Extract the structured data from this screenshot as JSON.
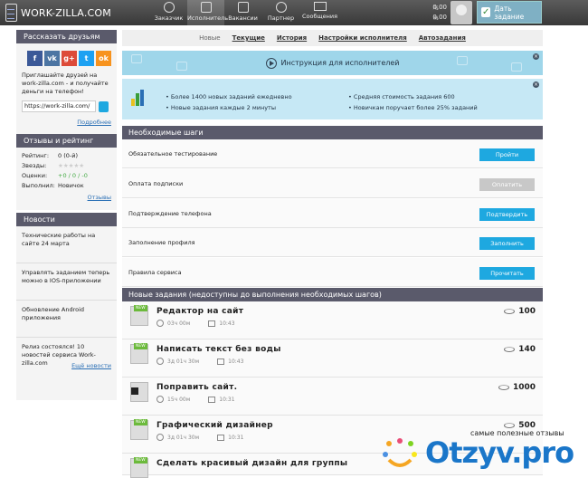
{
  "header": {
    "logo": "WORK-ZILLA.COM",
    "nav": [
      {
        "label": "Заказчик"
      },
      {
        "label": "Исполнитель"
      },
      {
        "label": "Вакансии"
      },
      {
        "label": "Партнер"
      },
      {
        "label": "Сообщения"
      }
    ],
    "balance1": "0,00",
    "balance2": "0,00",
    "task_button": "Дать задание"
  },
  "sidebar": {
    "share": {
      "title": "Рассказать друзьям",
      "text": "Приглашайте друзей на work-zilla.com - и получайте деньги на телефон!",
      "link_value": "https://work-zilla.com/",
      "more": "Подробнее",
      "networks": [
        {
          "label": "f",
          "color": "#3b5998"
        },
        {
          "label": "vk",
          "color": "#4c75a3"
        },
        {
          "label": "g+",
          "color": "#dd4b39"
        },
        {
          "label": "t",
          "color": "#1da1f2"
        },
        {
          "label": "ok",
          "color": "#f7931e"
        }
      ]
    },
    "rating": {
      "title": "Отзывы и рейтинг",
      "rows": [
        {
          "k": "Рейтинг:",
          "v": "0 (0-й)"
        },
        {
          "k": "Звезды:",
          "v": "★★★★★"
        },
        {
          "k": "Оценки:",
          "v": "+0 / 0 / -0"
        },
        {
          "k": "Выполнил:",
          "v": "Новичок"
        }
      ],
      "reviews": "Отзывы"
    },
    "news": {
      "title": "Новости",
      "items": [
        "Технические работы на сайте 24 марта",
        "Управлять заданием теперь можно в IOS-приложении",
        "Обновление Android приложения",
        "Релиз состоялся! 10 новостей сервиса Work-zilla.com"
      ],
      "more": "Ещё новости"
    }
  },
  "tabs": [
    {
      "label": "Новые"
    },
    {
      "label": "Текущие"
    },
    {
      "label": "История"
    },
    {
      "label": "Настройки исполнителя"
    },
    {
      "label": "Автозадания"
    }
  ],
  "promo": {
    "text": "Инструкция для исполнителей"
  },
  "stats": {
    "left": [
      "Более 1400 новых заданий ежедневно",
      "Новые задания каждые 2 минуты"
    ],
    "right": [
      "Средняя стоимость задания 600",
      "Новичкам поручает более 25% заданий"
    ]
  },
  "steps": {
    "title": "Необходимые шаги",
    "items": [
      {
        "label": "Обязательное тестирование",
        "button": "Пройти",
        "enabled": true
      },
      {
        "label": "Оплата подписки",
        "button": "Оплатить",
        "enabled": false
      },
      {
        "label": "Подтверждение телефона",
        "button": "Подтвердить",
        "enabled": true
      },
      {
        "label": "Заполнение профиля",
        "button": "Заполнить",
        "enabled": true
      },
      {
        "label": "Правила сервиса",
        "button": "Прочитать",
        "enabled": true
      }
    ]
  },
  "tasks": {
    "title": "Новые задания (недоступны до выполнения необходимых шагов)",
    "items": [
      {
        "title": "Редактор на сайт",
        "duration": "03ч 00м",
        "time": "10:43",
        "price": "100"
      },
      {
        "title": "Написать текст без воды",
        "duration": "3д 01ч 30м",
        "time": "10:43",
        "price": "140"
      },
      {
        "title": "Поправить сайт.",
        "duration": "15ч 00м",
        "time": "10:31",
        "price": "1000"
      },
      {
        "title": "Графический дизайнер",
        "duration": "3д 01ч 30м",
        "time": "10:31",
        "price": "500"
      },
      {
        "title": "Сделать красивый дизайн для группы",
        "duration": "",
        "time": "",
        "price": ""
      }
    ]
  },
  "watermark": {
    "caption": "самые полезные отзывы",
    "logo": "Otzyv.pro"
  }
}
